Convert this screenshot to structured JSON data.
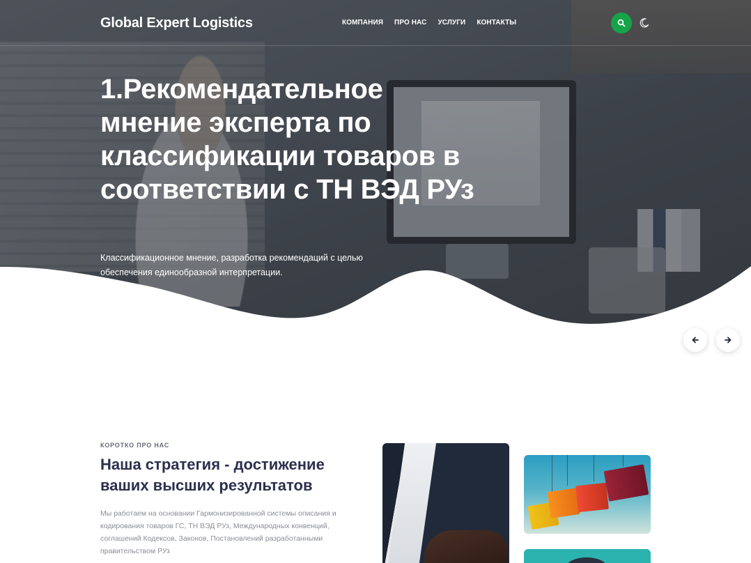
{
  "header": {
    "logo": "Global Expert Logistics",
    "nav": [
      "КОМПАНИЯ",
      "ПРО НАС",
      "УСЛУГИ",
      "КОНТАКТЫ"
    ],
    "search_icon": "search-icon",
    "theme_icon": "moon-icon"
  },
  "hero": {
    "title": "1.Рекомендательное мнение эксперта по классификации товаров в соответствии с ТН ВЭД РУз",
    "subtitle": "Классификационное мнение, разработка рекомендаций с целью обеспечения единообразной интерпретации.",
    "prev_icon": "arrow-left-icon",
    "next_icon": "arrow-right-icon"
  },
  "about": {
    "eyebrow": "КОРОТКО ПРО НАС",
    "title": "Наша стратегия - достижение ваших высших результатов",
    "text": "Мы работаем на основании Гармонизированной системы описания и кодирования товаров ГС, ТН ВЭД РУз, Международных конвенций, соглашений Кодексов, Законов, Постановлений разработанными правительством РУз"
  },
  "colors": {
    "accent_green": "#16a34a",
    "heading_navy": "#2d2f4e",
    "body_gray": "#8a8d94"
  }
}
